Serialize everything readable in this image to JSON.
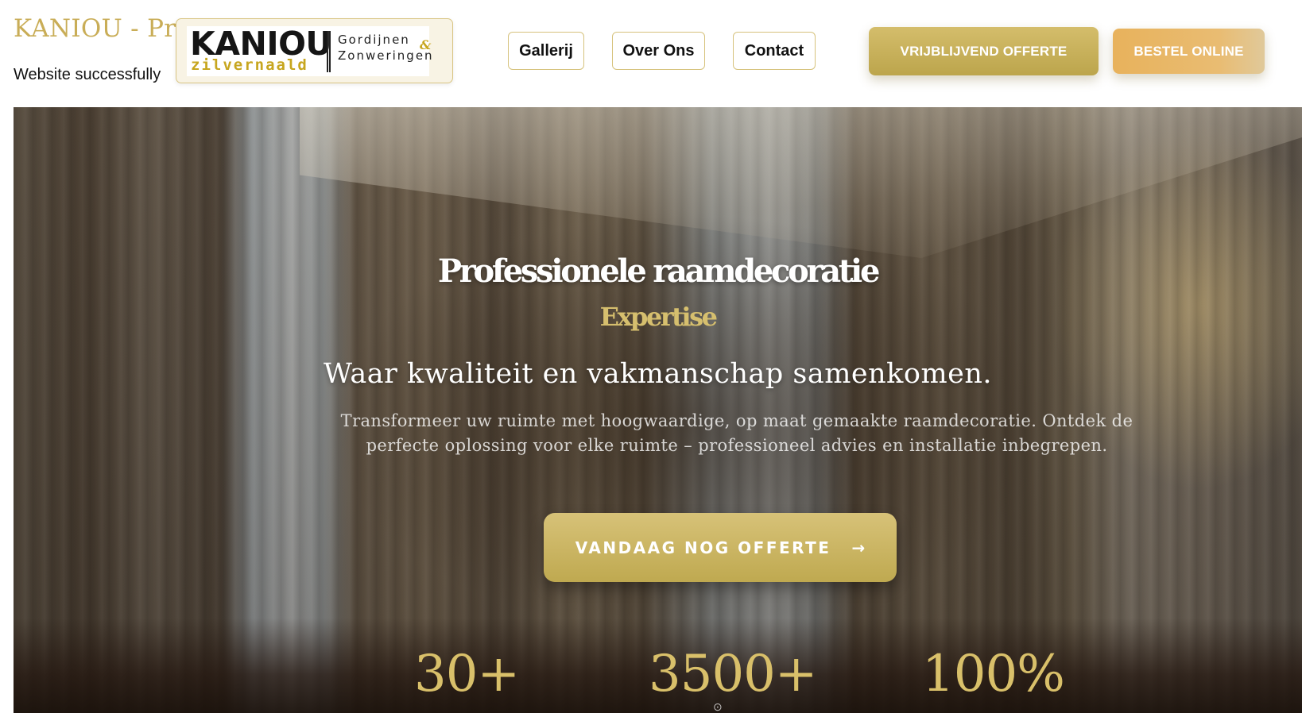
{
  "page": {
    "title": "KANIOU - Pro                                    nts",
    "status_text": "Website successfully"
  },
  "logo": {
    "main": "KANIOU",
    "sub": "zilvernaald",
    "right_line_1": "Gordijnen",
    "right_line_2": "Zonweringen",
    "ampersand": "&"
  },
  "nav": {
    "items": [
      {
        "label": "Gallerij"
      },
      {
        "label": "Over Ons"
      },
      {
        "label": "Contact"
      }
    ],
    "cta_offerte": "VRIJBLIJVEND OFFERTE",
    "cta_bestel": "BESTEL ONLINE"
  },
  "hero": {
    "title": "Professionele raamdecoratie",
    "subtitle": "Expertise",
    "tagline": "Waar kwaliteit en vakmanschap samenkomen.",
    "description": "Transformeer uw ruimte met hoogwaardige, op maat gemaakte raamdecoratie. Ontdek de perfecte oplossing voor elke ruimte – professioneel advies en installatie inbegrepen.",
    "cta_label": "VANDAAG NOG OFFERTE",
    "cta_arrow": "→"
  },
  "stats": [
    {
      "value": "30+"
    },
    {
      "value": "3500+"
    },
    {
      "value": "100%"
    }
  ],
  "colors": {
    "gold": "#c9ad57",
    "gold_button": "#c7b05a",
    "orange_button": "#e8b25c"
  },
  "icons": {
    "cta_arrow": "arrow-right-icon"
  }
}
